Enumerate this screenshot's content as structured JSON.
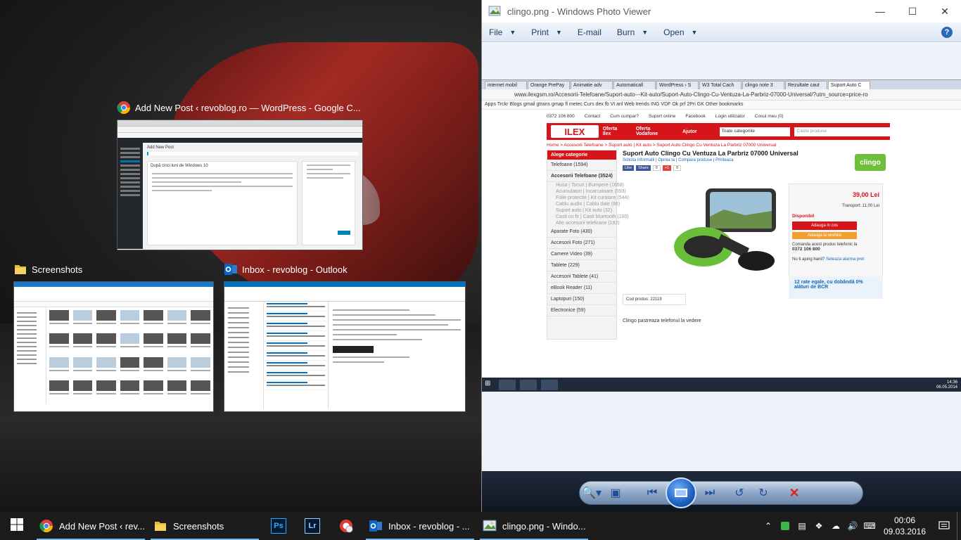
{
  "task_view": {
    "chrome": {
      "title": "Add New Post ‹ revoblog.ro — WordPress - Google C...",
      "page_title": "Add New Post",
      "post_title": "După cinci luni de Windows 10"
    },
    "explorer": {
      "title": "Screenshots"
    },
    "outlook": {
      "title": "Inbox - revoblog - Outlook"
    }
  },
  "photo_viewer": {
    "title": "clingo.png - Windows Photo Viewer",
    "menu": [
      "File",
      "Print",
      "E-mail",
      "Burn",
      "Open"
    ],
    "menu_has_arrow": [
      true,
      true,
      false,
      true,
      true
    ],
    "help_label": "?",
    "screenshot": {
      "tabs": [
        "internet mobil",
        "Orange PrePay",
        "Animatie adv",
        "Automaticall",
        "WordPress › S",
        "W3 Total Cach",
        "clingo note 3",
        "Rezultate caut",
        "Suport Auto C"
      ],
      "url": "www.ilexgsm.ro/Accesorii-Telefoane/Suport-auto---Kit-auto/Suport-Auto-Clingo-Cu-Ventuza-La-Parbriz-07000-Universal/?utm_source=price-ro",
      "bookmarks": "Apps   Trckr   Blogs   gmail   gtrans   gmap   fl   metec   Curs   dex   fb   Vt   anl   Web   trends   ING   VDF   Ok   prf   2Pri   GK   Other bookmarks",
      "top_bar": [
        "0372 106 800",
        "Contact",
        "Cum cumpar?",
        "Suport online",
        "Facebook",
        "Login utilizator",
        "Cosul meu (0)"
      ],
      "logo": "ILEX",
      "nav": [
        "Oferta Ilex",
        "Oferta Vodafone",
        "Ajutor"
      ],
      "category_select": "Toate categoriile",
      "search_placeholder": "Cauta produse",
      "breadcrumb": "Home > Accesorii Telefoane > Suport auto | Kit auto > Suport Auto Clingo Cu Ventuza La Parbriz 07000 Universal",
      "categories_header": "Alege categorie",
      "categories": [
        "Telefoane (1594)",
        "Accesorii Telefoane (3524)"
      ],
      "subcategories": [
        "Husa | Tocuri | Bumpere (1658)",
        "Acumulatori | Incarcatoare (593)",
        "Folie protectie | Kit curatare (544)",
        "Cablu audio | Cablu date (86)",
        "Suport auto | Kit auto (32)",
        "Casti cu fir | Casti bluetooth (100)",
        "Alte accesorii telefoane (192)"
      ],
      "categories_more": [
        "Aparate Foto (430)",
        "Accesorii Foto (271)",
        "Camere Video (39)",
        "Tablete (229)",
        "Accesorii Tablete (41)",
        "eBook Reader (11)",
        "Laptopuri (150)",
        "Electronice (59)"
      ],
      "product_title": "Suport Auto Clingo Cu Ventuza La Parbriz 07000 Universal",
      "product_links": "Solicita informatii | Opinia ta | Compara produse | Printeaza",
      "social": [
        "Like",
        "Share",
        "0",
        "+1",
        "0"
      ],
      "brand": "clingo",
      "price": "39,00 Lei",
      "transport": "Transport: 11,00 Lei",
      "availability": "Disponibil",
      "add_cart": "Adauga in cos",
      "add_wishlist": "Adauga la wishlist",
      "phone_order": "Comanda acest produs telefonic la",
      "phone": "0372 106 800",
      "card_question": "Nu ti ajung banii?",
      "card_link": "Seteaza alarma pret",
      "rates": "12 rate egale, cu dobândă 0% alături de BCR",
      "product_code": "Cod produs: 22119",
      "description": "Clingo pastreaza telefonul la vedere",
      "tray_time": "14:36",
      "tray_date": "06.05.2014"
    }
  },
  "taskbar": {
    "items": [
      {
        "label": "Add New Post ‹ rev...",
        "icon": "chrome-icon"
      },
      {
        "label": "Screenshots",
        "icon": "folder-icon"
      },
      {
        "label": "",
        "icon": "photoshop-icon",
        "text": "Ps"
      },
      {
        "label": "",
        "icon": "lightroom-icon",
        "text": "Lr"
      },
      {
        "label": "",
        "icon": "chrome-alt-icon"
      },
      {
        "label": "Inbox - revoblog - ...",
        "icon": "outlook-icon"
      },
      {
        "label": "clingo.png - Windo...",
        "icon": "photo-viewer-icon"
      }
    ],
    "clock": {
      "time": "00:06",
      "date": "09.03.2016"
    }
  }
}
